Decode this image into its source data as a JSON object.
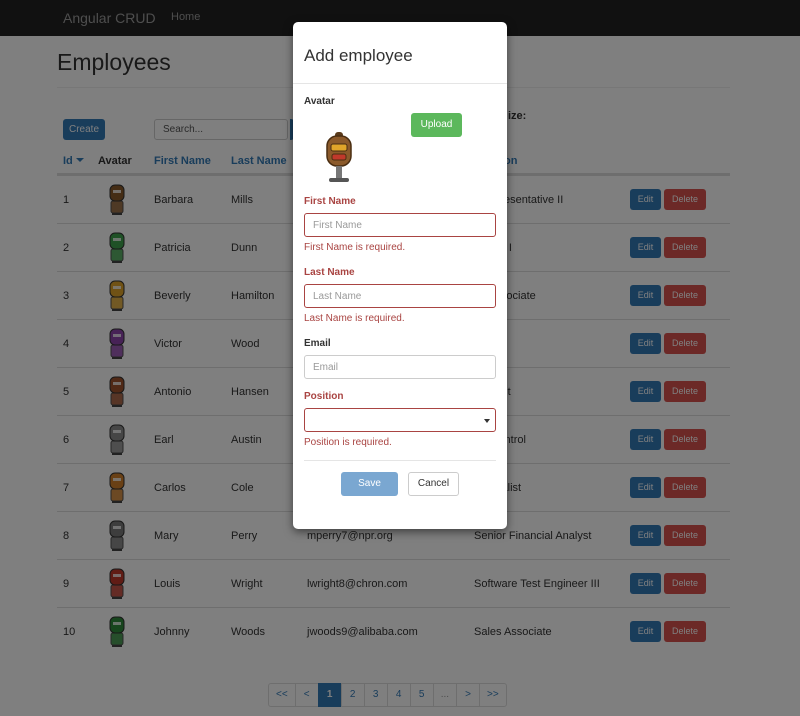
{
  "navbar": {
    "brand": "Angular CRUD",
    "home": "Home"
  },
  "page": {
    "title": "Employees"
  },
  "toolbar": {
    "create_label": "Create",
    "search_placeholder": "Search...",
    "page_size_label_partial": "ize:"
  },
  "table": {
    "headers": {
      "id": "Id",
      "avatar": "Avatar",
      "first_name": "First Name",
      "last_name": "Last Name",
      "position_partial": "on"
    },
    "rows": [
      {
        "id": "1",
        "first": "Barbara",
        "last": "Mills",
        "email": "",
        "position": "t Representative II",
        "avatar_color": "#8b5a2b"
      },
      {
        "id": "2",
        "first": "Patricia",
        "last": "Dunn",
        "email": "",
        "position": "Coach I",
        "avatar_color": "#3fa34d"
      },
      {
        "id": "3",
        "first": "Beverly",
        "last": "Hamilton",
        "email": "",
        "position": "ch Associate",
        "avatar_color": "#e0a52a"
      },
      {
        "id": "4",
        "first": "Victor",
        "last": "Wood",
        "email": "",
        "position": "ist II",
        "avatar_color": "#8e44ad"
      },
      {
        "id": "5",
        "first": "Antonio",
        "last": "Hansen",
        "email": "",
        "position": "ountant",
        "avatar_color": "#a0522d"
      },
      {
        "id": "6",
        "first": "Earl",
        "last": "Austin",
        "email": "",
        "position": "lity Control",
        "avatar_color": "#8c8c8c"
      },
      {
        "id": "7",
        "first": "Carlos",
        "last": "Cole",
        "email": "",
        "position": "Specialist",
        "avatar_color": "#d2802a"
      },
      {
        "id": "8",
        "first": "Mary",
        "last": "Perry",
        "email": "mperry7@npr.org",
        "position": "Senior Financial Analyst",
        "avatar_color": "#7a7a7a"
      },
      {
        "id": "9",
        "first": "Louis",
        "last": "Wright",
        "email": "lwright8@chron.com",
        "position": "Software Test Engineer III",
        "avatar_color": "#c0392b"
      },
      {
        "id": "10",
        "first": "Johnny",
        "last": "Woods",
        "email": "jwoods9@alibaba.com",
        "position": "Sales Associate",
        "avatar_color": "#2e8b3a"
      }
    ],
    "edit_label": "Edit",
    "delete_label": "Delete"
  },
  "pagination": {
    "items": [
      {
        "label": "<<",
        "state": "normal"
      },
      {
        "label": "<",
        "state": "normal"
      },
      {
        "label": "1",
        "state": "active"
      },
      {
        "label": "2",
        "state": "normal"
      },
      {
        "label": "3",
        "state": "normal"
      },
      {
        "label": "4",
        "state": "normal"
      },
      {
        "label": "5",
        "state": "normal"
      },
      {
        "label": "...",
        "state": "disabled"
      },
      {
        "label": ">",
        "state": "normal"
      },
      {
        "label": ">>",
        "state": "normal"
      }
    ]
  },
  "modal": {
    "title": "Add employee",
    "avatar_label": "Avatar",
    "upload_label": "Upload",
    "first_name": {
      "label": "First Name",
      "placeholder": "First Name",
      "value": "",
      "error": "First Name is required."
    },
    "last_name": {
      "label": "Last Name",
      "placeholder": "Last Name",
      "value": "",
      "error": "Last Name is required."
    },
    "email": {
      "label": "Email",
      "placeholder": "Email",
      "value": ""
    },
    "position": {
      "label": "Position",
      "selected": "",
      "error": "Position is required."
    },
    "save_label": "Save",
    "cancel_label": "Cancel",
    "avatar_color": "#8b5a2b"
  },
  "colors": {
    "primary": "#337ab7",
    "danger": "#d9534f",
    "success": "#5cb85c",
    "error_text": "#a94442",
    "navbar": "#222222"
  }
}
